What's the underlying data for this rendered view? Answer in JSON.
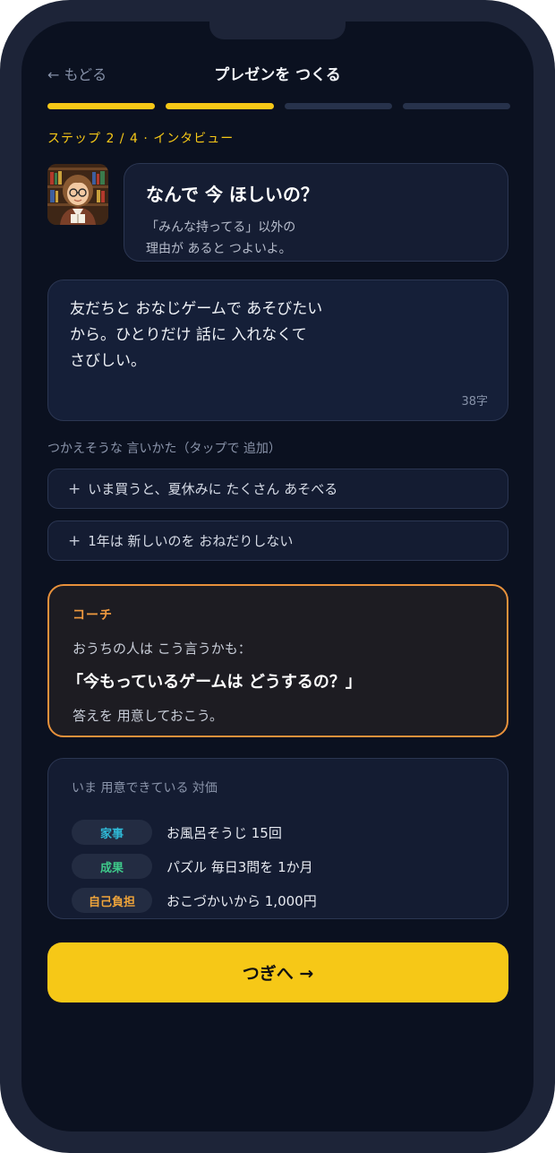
{
  "header": {
    "back_label": "← もどる",
    "title": "プレゼンを つくる"
  },
  "progress": {
    "completed_steps": 2,
    "total_steps": 4,
    "step_label": "ステップ 2 / 4 · インタビュー"
  },
  "interviewer": {
    "avatar_icon": "librarian-avatar-icon",
    "question": "なんで 今 ほしいの？",
    "hint_line1": "「みんな持ってる」以外の",
    "hint_line2": "理由が あると つよいよ。"
  },
  "answer": {
    "line1": "友だちと おなじゲームで あそびたい",
    "line2": "から。ひとりだけ 話に 入れなくて",
    "line3": "さびしい。",
    "char_count": "38字"
  },
  "suggestions": {
    "heading": "つかえそうな 言いかた（タップで 追加）",
    "items": [
      {
        "plus": "+",
        "text": "いま買うと、夏休みに たくさん あそべる"
      },
      {
        "plus": "+",
        "text": "1年は 新しいのを おねだりしない"
      }
    ]
  },
  "coach": {
    "label": "コーチ",
    "line": "おうちの人は こう言うかも：",
    "quote": "「今もっているゲームは どうするの？」",
    "tip": "答えを 用意しておこう。",
    "accent_color": "#e8913b"
  },
  "offers": {
    "title": "いま 用意できている 対価",
    "items": [
      {
        "tag": "家事",
        "tag_color": "#2fb8d6",
        "text": "お風呂そうじ 15回"
      },
      {
        "tag": "成果",
        "tag_color": "#3ec98a",
        "text": "パズル 毎日3問を 1か月"
      },
      {
        "tag": "自己負担",
        "tag_color": "#f0a53a",
        "text": "おこづかいから 1,000円"
      }
    ]
  },
  "next_button": {
    "label": "つぎへ →",
    "color": "#f6c817"
  }
}
